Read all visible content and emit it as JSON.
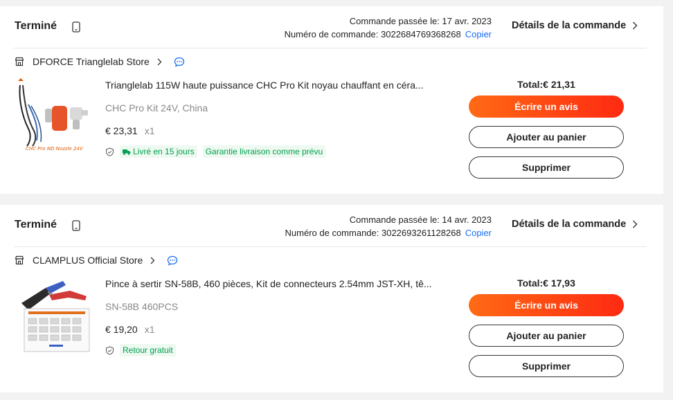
{
  "orders": [
    {
      "status": "Terminé",
      "placed_label": "Commande passée le: 17 avr. 2023",
      "order_number_label": "Numéro de commande: 3022684769368268",
      "copy_label": "Copier",
      "details_label": "Détails de la commande",
      "store_name": "DFORCE Trianglelab Store",
      "product_title": "Trianglelab 115W haute puissance CHC Pro Kit noyau chauffant en céra...",
      "variant": "CHC Pro Kit 24V, China",
      "price": "€ 23,31",
      "quantity": "x1",
      "tags": [
        "Livré en 15 jours",
        "Garantie livraison comme prévu"
      ],
      "thumb_caption": "CHC Pro ND Nozzle 24V",
      "total": "Total:€ 21,31",
      "review_label": "Écrire un avis",
      "add_to_cart_label": "Ajouter au panier",
      "delete_label": "Supprimer"
    },
    {
      "status": "Terminé",
      "placed_label": "Commande passée le: 14 avr. 2023",
      "order_number_label": "Numéro de commande: 3022693261128268",
      "copy_label": "Copier",
      "details_label": "Détails de la commande",
      "store_name": "CLAMPLUS Official Store",
      "product_title": "Pince à sertir SN-58B, 460 pièces, Kit de connecteurs 2.54mm JST-XH, tê...",
      "variant": "SN-58B 460PCS",
      "price": "€ 19,20",
      "quantity": "x1",
      "tags": [
        "Retour gratuit"
      ],
      "total": "Total:€ 17,93",
      "review_label": "Écrire un avis",
      "add_to_cart_label": "Ajouter au panier",
      "delete_label": "Supprimer"
    }
  ],
  "colors": {
    "accent_start": "#ff6a15",
    "accent_end": "#fe2a12",
    "link": "#1a6ef5",
    "tag_green": "#00a04e"
  }
}
